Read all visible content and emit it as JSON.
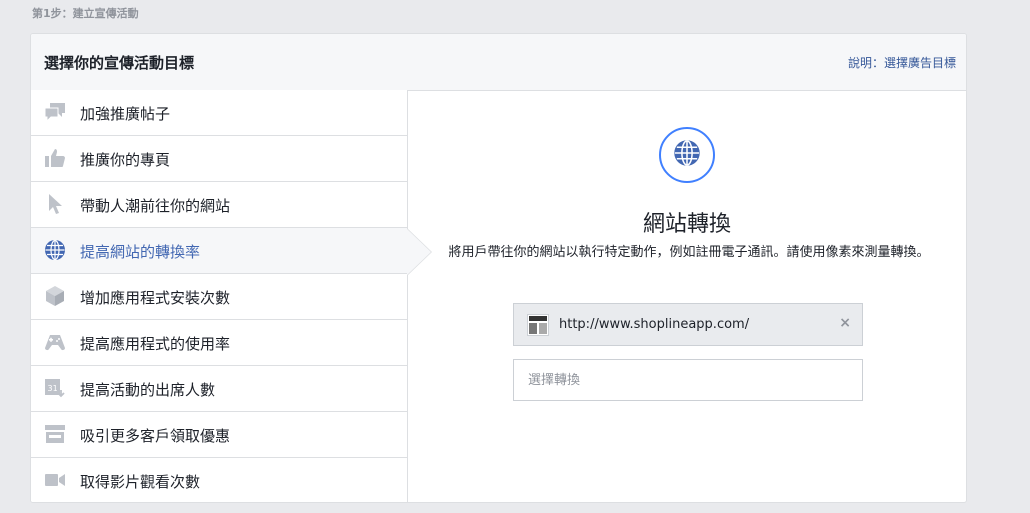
{
  "step_label": "第1步：建立宣傳活動",
  "panel": {
    "title": "選擇你的宣傳活動目標",
    "help_prefix": "說明：",
    "help_link": "選擇廣告目標"
  },
  "sidebar": {
    "items": [
      {
        "label": "加強推廣帖子",
        "icon": "speech-bubble-icon"
      },
      {
        "label": "推廣你的專頁",
        "icon": "thumbs-up-icon"
      },
      {
        "label": "帶動人潮前往你的網站",
        "icon": "cursor-icon"
      },
      {
        "label": "提高網站的轉換率",
        "icon": "globe-icon",
        "active": true
      },
      {
        "label": "增加應用程式安裝次數",
        "icon": "cube-icon"
      },
      {
        "label": "提高應用程式的使用率",
        "icon": "gamepad-icon"
      },
      {
        "label": "提高活動的出席人數",
        "icon": "calendar-icon"
      },
      {
        "label": "吸引更多客戶領取優惠",
        "icon": "store-icon"
      },
      {
        "label": "取得影片觀看次數",
        "icon": "video-camera-icon"
      }
    ]
  },
  "main": {
    "title": "網站轉換",
    "description": "將用戶帶往你的網站以執行特定動作，例如註冊電子通訊。請使用像素來測量轉換。",
    "url": "http://www.shoplineapp.com/",
    "close_glyph": "×",
    "select_placeholder": "選擇轉換"
  },
  "colors": {
    "accent": "#4267b2",
    "globe_ring": "#4080ff",
    "icon_gray": "#bec2c9"
  }
}
